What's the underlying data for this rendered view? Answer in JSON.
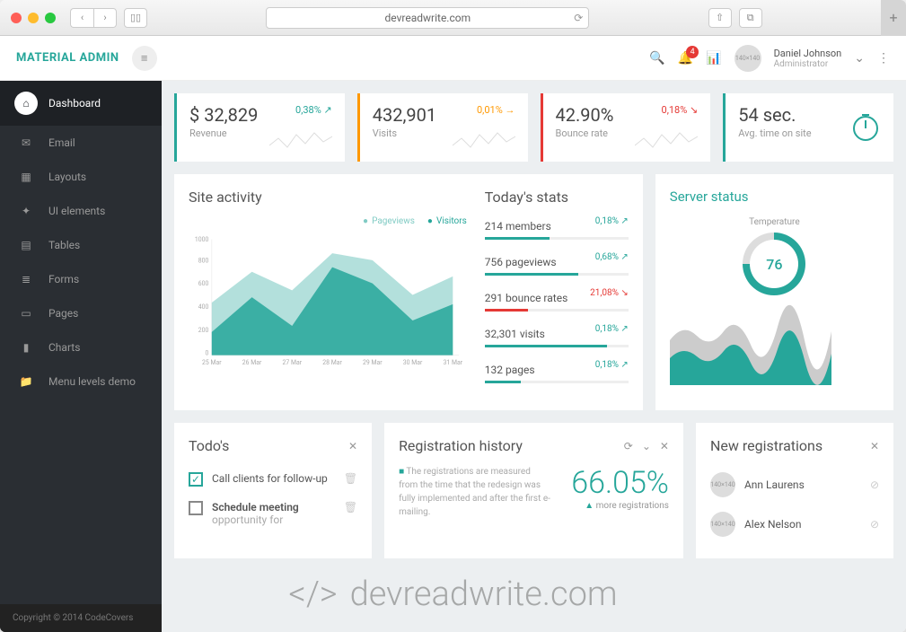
{
  "browser": {
    "url": "devreadwrite.com"
  },
  "brand": "MATERIAL ADMIN",
  "user": {
    "name": "Daniel Johnson",
    "role": "Administrator"
  },
  "notif_count": "4",
  "sidebar": {
    "items": [
      {
        "label": "Dashboard",
        "icon": "home"
      },
      {
        "label": "Email",
        "icon": "mail"
      },
      {
        "label": "Layouts",
        "icon": "layout"
      },
      {
        "label": "UI elements",
        "icon": "puzzle"
      },
      {
        "label": "Tables",
        "icon": "grid"
      },
      {
        "label": "Forms",
        "icon": "form"
      },
      {
        "label": "Pages",
        "icon": "monitor"
      },
      {
        "label": "Charts",
        "icon": "bar"
      },
      {
        "label": "Menu levels demo",
        "icon": "folder"
      }
    ],
    "footer": "Copyright © 2014 CodeCovers"
  },
  "kpis": [
    {
      "value": "$ 32,829",
      "label": "Revenue",
      "pct": "0,38%",
      "trend": "up",
      "color": "#26a69a"
    },
    {
      "value": "432,901",
      "label": "Visits",
      "pct": "0,01%",
      "trend": "flat",
      "color": "#ff9800"
    },
    {
      "value": "42.90%",
      "label": "Bounce rate",
      "pct": "0,18%",
      "trend": "down",
      "color": "#e53935"
    },
    {
      "value": "54 sec.",
      "label": "Avg. time on site",
      "pct": "",
      "trend": "timer",
      "color": "#26a69a"
    }
  ],
  "activity": {
    "title": "Site activity",
    "legend": [
      "Pageviews",
      "Visitors"
    ],
    "xaxis": [
      "25 Mar",
      "26 Mar",
      "27 Mar",
      "28 Mar",
      "29 Mar",
      "30 Mar",
      "31 Mar"
    ]
  },
  "todays": {
    "title": "Today's stats",
    "rows": [
      {
        "label": "214 members",
        "pct": "0,18%",
        "color": "#26a69a",
        "dir": "up",
        "bar": 45
      },
      {
        "label": "756 pageviews",
        "pct": "0,68%",
        "color": "#26a69a",
        "dir": "up",
        "bar": 65
      },
      {
        "label": "291 bounce rates",
        "pct": "21,08%",
        "color": "#e53935",
        "dir": "down",
        "bar": 30
      },
      {
        "label": "32,301 visits",
        "pct": "0,18%",
        "color": "#26a69a",
        "dir": "up",
        "bar": 85
      },
      {
        "label": "132 pages",
        "pct": "0,18%",
        "color": "#26a69a",
        "dir": "up",
        "bar": 25
      }
    ]
  },
  "server": {
    "title": "Server status",
    "gauge_label": "Temperature",
    "gauge_value": "76"
  },
  "todos": {
    "title": "Todo's",
    "items": [
      {
        "text": "Call clients for follow-up",
        "done": true
      },
      {
        "text": "Schedule meeting",
        "sub": "opportunity for",
        "done": false,
        "bold": true
      }
    ]
  },
  "registration": {
    "title": "Registration history",
    "note": "The registrations are measured from the time that the redesign was fully implemented and after the first e-mailing.",
    "big": "66.05%",
    "sub": "more registrations"
  },
  "newreg": {
    "title": "New registrations",
    "items": [
      {
        "name": "Ann Laurens"
      },
      {
        "name": "Alex Nelson"
      }
    ]
  },
  "chart_data": {
    "type": "area",
    "x": [
      "25 Mar",
      "26 Mar",
      "27 Mar",
      "28 Mar",
      "29 Mar",
      "30 Mar",
      "31 Mar"
    ],
    "series": [
      {
        "name": "Pageviews",
        "values": [
          460,
          720,
          560,
          880,
          820,
          520,
          680
        ]
      },
      {
        "name": "Visitors",
        "values": [
          200,
          500,
          250,
          760,
          620,
          300,
          440
        ]
      }
    ],
    "ylim": [
      0,
      1000
    ],
    "ylabel": "",
    "xlabel": ""
  },
  "watermark": "devreadwrite.com"
}
